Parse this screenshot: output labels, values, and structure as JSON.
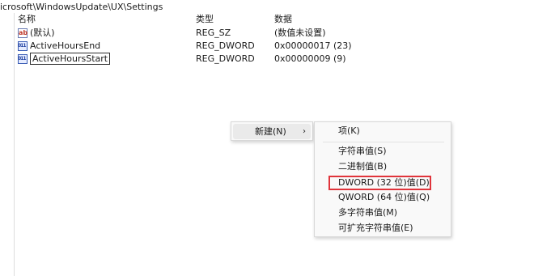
{
  "address": "icrosoft\\WindowsUpdate\\UX\\Settings",
  "columns": {
    "name": "名称",
    "type": "类型",
    "data": "数据"
  },
  "rows": [
    {
      "icon": "string-value-icon",
      "name": "(默认)",
      "type": "REG_SZ",
      "data": "(数值未设置)"
    },
    {
      "icon": "binary-value-icon",
      "name": "ActiveHoursEnd",
      "type": "REG_DWORD",
      "data": "0x00000017 (23)"
    },
    {
      "icon": "binary-value-icon",
      "name": "ActiveHoursStart",
      "type": "REG_DWORD",
      "data": "0x00000009 (9)"
    }
  ],
  "context_menu": {
    "new_label": "新建(N)",
    "arrow": "›"
  },
  "submenu": {
    "key": "项(K)",
    "string": "字符串值(S)",
    "binary": "二进制值(B)",
    "dword": "DWORD (32 位)值(D)",
    "qword": "QWORD (64 位)值(Q)",
    "multi_string": "多字符串值(M)",
    "expandable_string": "可扩充字符串值(E)"
  },
  "highlight_color": "#e0343b"
}
